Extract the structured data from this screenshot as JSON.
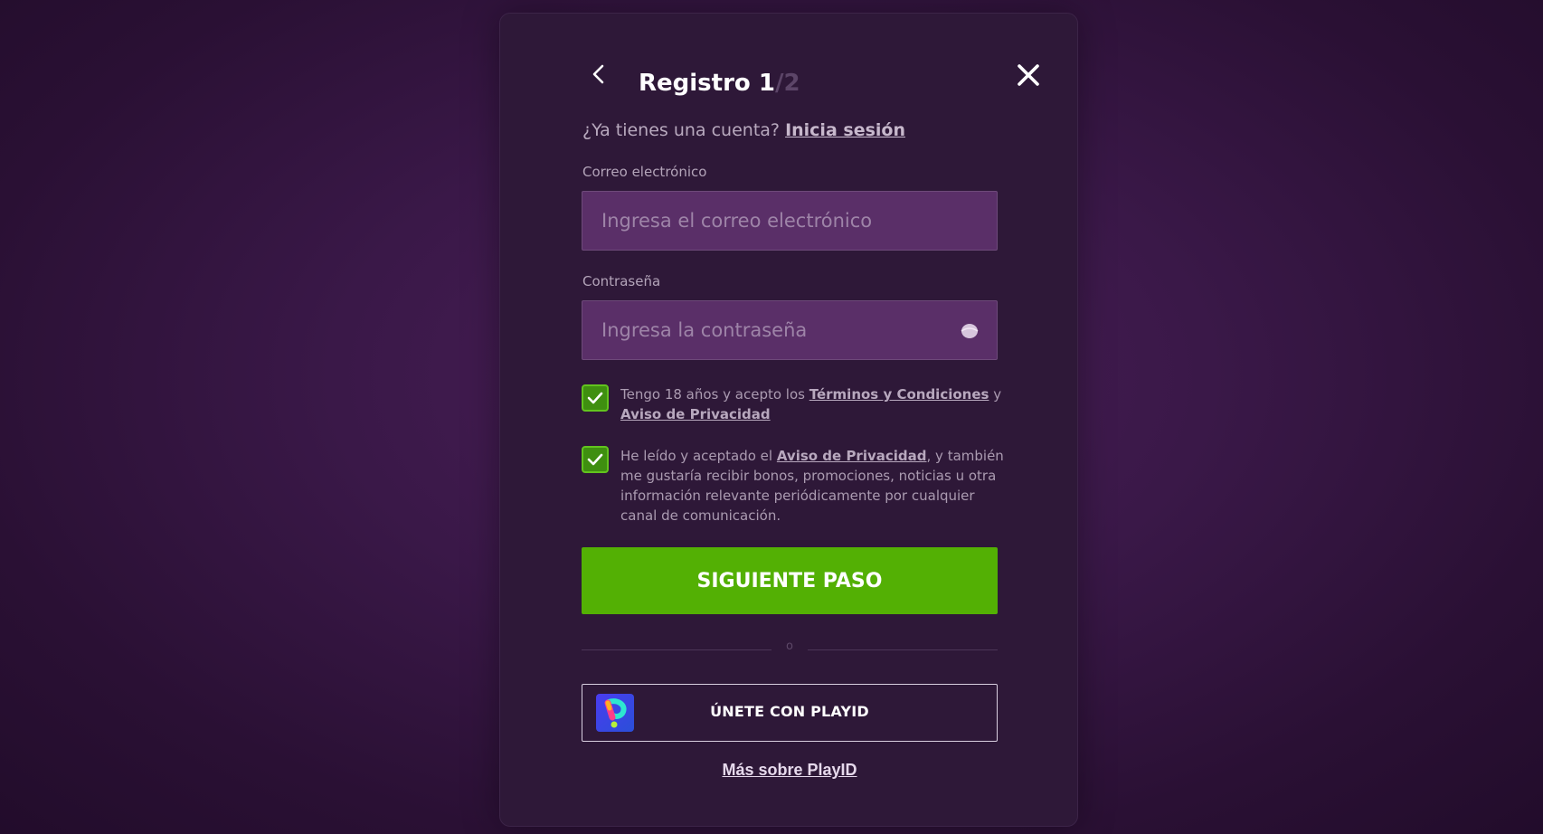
{
  "modal": {
    "title": "Registro",
    "step_current": "1",
    "step_separator": "/",
    "step_total": "2",
    "back_icon": "chevron-left-icon",
    "close_icon": "close-icon"
  },
  "login_prompt": {
    "text": "¿Ya tienes una cuenta?",
    "link": "Inicia sesión"
  },
  "email": {
    "label": "Correo electrónico",
    "placeholder": "Ingresa el correo electrónico",
    "value": ""
  },
  "password": {
    "label": "Contraseña",
    "placeholder": "Ingresa la contraseña",
    "value": "",
    "toggle_icon": "eye-icon"
  },
  "checkbox_terms": {
    "checked": true,
    "text_before": "Tengo 18 años y acepto los",
    "link_terms": "Términos y Condiciones",
    "text_and": "y",
    "link_privacy": "Aviso de Privacidad"
  },
  "checkbox_marketing": {
    "checked": true,
    "text_before": "He leído y aceptado el",
    "link_privacy": "Aviso de Privacidad",
    "text_after": ", y también me gustaría recibir bonos, promociones, noticias u otra información relevante periódicamente por cualquier canal de comunicación."
  },
  "next_button": {
    "label": "SIGUIENTE PASO"
  },
  "divider": {
    "text": "o"
  },
  "playid": {
    "label": "ÚNETE CON PLAYID",
    "more_link": "Más sobre PlayID",
    "logo_icon": "playid-logo-icon"
  },
  "colors": {
    "background": "#3a1848",
    "modal": "#2e1838",
    "input_background": "#5a2f68",
    "primary_button": "#53b004",
    "checkbox": "#3f8f10"
  }
}
